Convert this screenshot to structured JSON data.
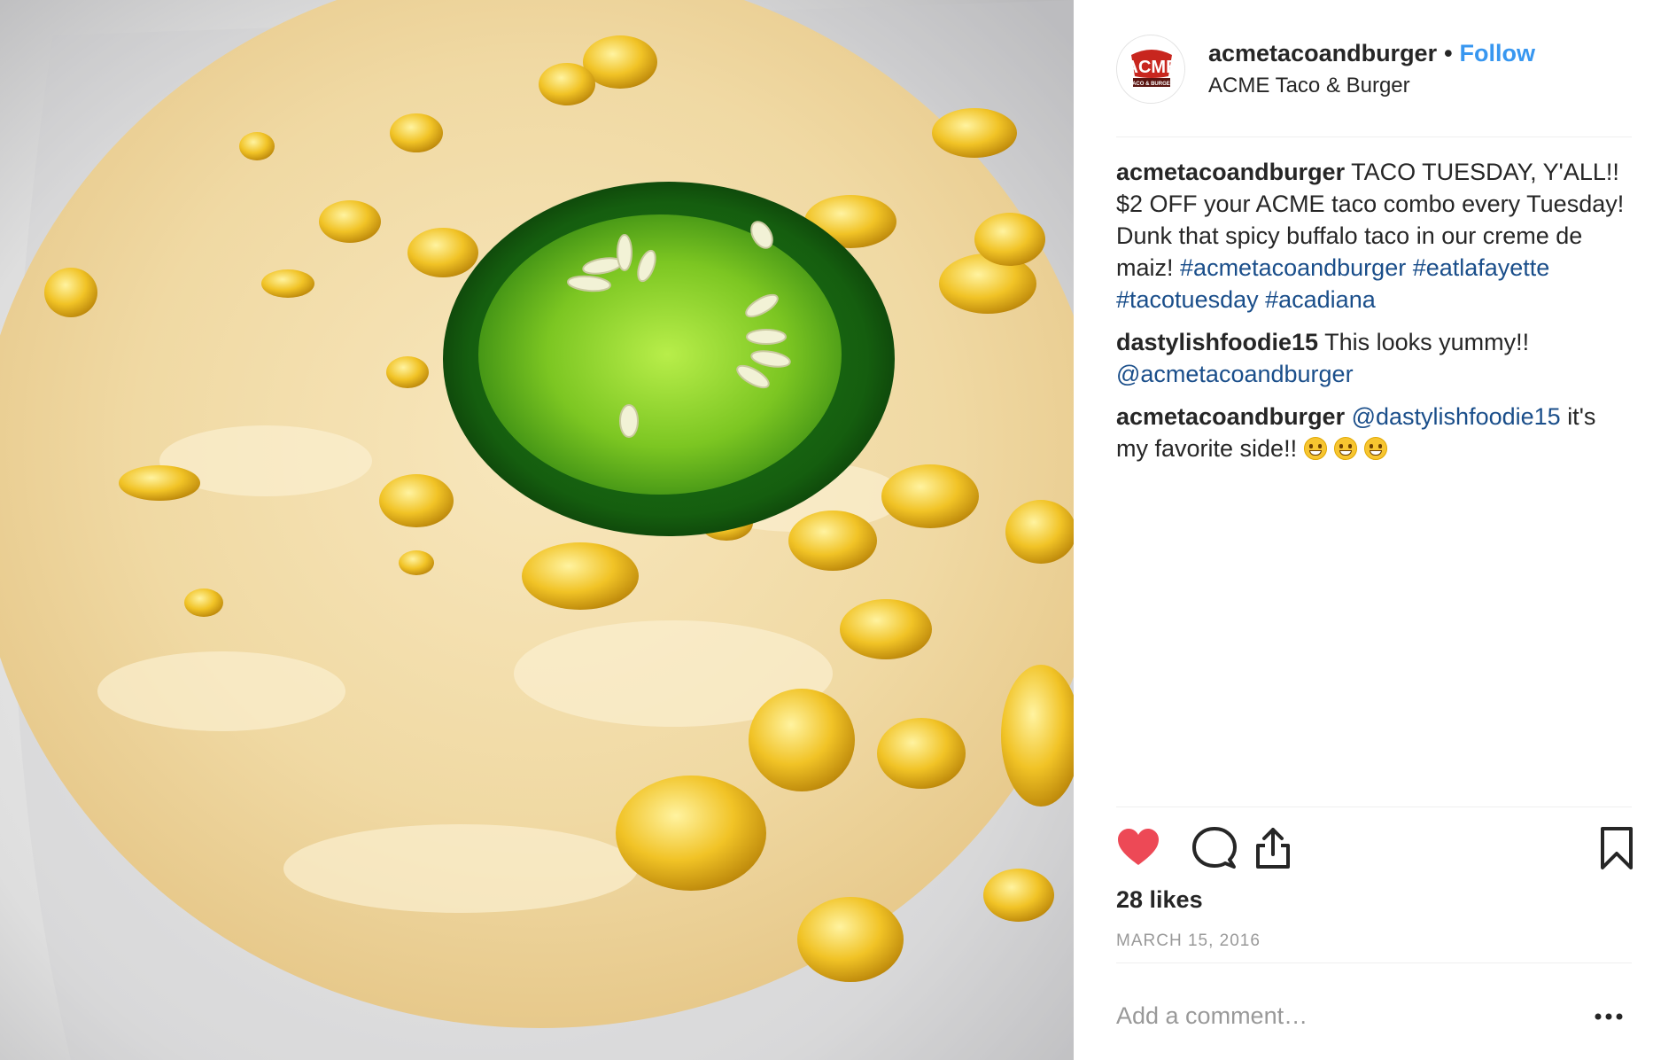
{
  "post": {
    "photo_alt": "Bowl of creamy corn soup topped with a jalapeño slice"
  },
  "header": {
    "avatar_text_top": "ACME",
    "avatar_text_bottom": "TACO & BURGER",
    "username": "acmetacoandburger",
    "separator": "•",
    "follow_label": "Follow",
    "location": "ACME Taco & Burger"
  },
  "comments": [
    {
      "user": "acmetacoandburger",
      "text": "TACO TUESDAY, Y'ALL!! $2 OFF your ACME taco combo every Tuesday! Dunk that spicy buffalo taco in our creme de maiz!",
      "hashtags": "#acmetacoandburger #eatlafayette #tacotuesday #acadiana"
    },
    {
      "user": "dastylishfoodie15",
      "text": "This looks yummy!!",
      "mention": "@acmetacoandburger"
    },
    {
      "user": "acmetacoandburger",
      "mention": "@dastylishfoodie15",
      "text": "it's my favorite side!!",
      "emoji": "grinning-face",
      "emoji_count": 3
    }
  ],
  "actions": {
    "like_icon": "heart-filled-icon",
    "comment_icon": "comment-bubble-icon",
    "share_icon": "share-icon",
    "save_icon": "bookmark-icon",
    "like_color": "#ed4956"
  },
  "likes": "28 likes",
  "date": "MARCH 15, 2016",
  "add_comment": {
    "placeholder": "Add a comment…",
    "value": ""
  },
  "more_icon": "more-options-icon",
  "colors": {
    "link": "#1a4e8a",
    "follow": "#3897f0",
    "muted": "#999999"
  }
}
